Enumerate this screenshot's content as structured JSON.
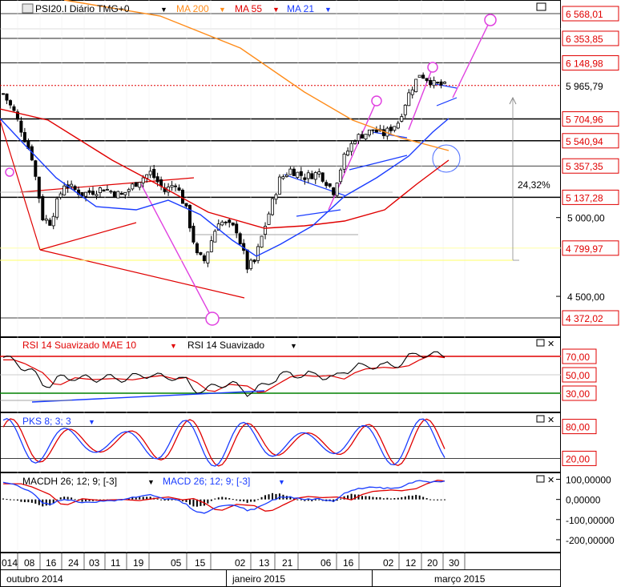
{
  "header": {
    "symbol": "PSI20.I Diário TMG+0",
    "ma200": "MA 200",
    "ma55": "MA 55",
    "ma21": "MA 21",
    "colors": {
      "ma200": "#ff8c1a",
      "ma55": "#e00000",
      "ma21": "#1a3cff"
    }
  },
  "chart_data": [
    {
      "type": "candlestick",
      "panel": "price",
      "price_labels": [
        {
          "value": 6568.01,
          "text": "6 568,01",
          "boxed": true
        },
        {
          "value": 6353.85,
          "text": "6 353,85",
          "boxed": true
        },
        {
          "value": 6148.98,
          "text": "6 148,98",
          "boxed": true
        },
        {
          "value": 5965.79,
          "text": "5 965,79",
          "boxed": false,
          "current": true
        },
        {
          "value": 5704.96,
          "text": "5 704,96",
          "boxed": true
        },
        {
          "value": 5540.94,
          "text": "5 540,94",
          "boxed": true
        },
        {
          "value": 5357.35,
          "text": "5 357,35",
          "boxed": true
        },
        {
          "value": 5137.28,
          "text": "5 137,28",
          "boxed": true
        },
        {
          "value": 5000,
          "text": "5 000,00",
          "boxed": false
        },
        {
          "value": 4799.97,
          "text": "4 799,97",
          "boxed": true
        },
        {
          "value": 4500,
          "text": "4 500,00",
          "boxed": false
        },
        {
          "value": 4372.02,
          "text": "4 372,02",
          "boxed": true
        }
      ],
      "annotation": "24,32%",
      "current_close": 5965.79
    },
    {
      "type": "line",
      "panel": "rsi",
      "labels": [
        "RSI 14 Suavizado MAE 10",
        "RSI 14 Suavizado"
      ],
      "levels": [
        {
          "value": 70,
          "text": "70,00"
        },
        {
          "value": 50,
          "text": "50,00"
        },
        {
          "value": 30,
          "text": "30,00"
        }
      ]
    },
    {
      "type": "line",
      "panel": "stochastic",
      "labels": [
        "PKS 8; 3; 3"
      ],
      "levels": [
        {
          "value": 80,
          "text": "80,00"
        },
        {
          "value": 20,
          "text": "20,00"
        }
      ]
    },
    {
      "type": "line",
      "panel": "macd",
      "labels": [
        "MACDH 26; 12; 9; [-3]",
        "MACD 26; 12; 9; [-3]"
      ],
      "levels": [
        {
          "value": 100,
          "text": "100,00000"
        },
        {
          "value": 0,
          "text": "0,00000"
        },
        {
          "value": -100,
          "text": "-100,00000"
        },
        {
          "value": -200,
          "text": "-200,00000"
        }
      ]
    }
  ],
  "xaxis": {
    "days": [
      "014",
      "08",
      "16",
      "24",
      "03",
      "11",
      "19",
      "05",
      "15",
      "02",
      "13",
      "21",
      "06",
      "16",
      "02",
      "12",
      "20",
      "30"
    ],
    "months": [
      "outubro 2014",
      "janeiro 2015",
      "março 2015"
    ]
  }
}
